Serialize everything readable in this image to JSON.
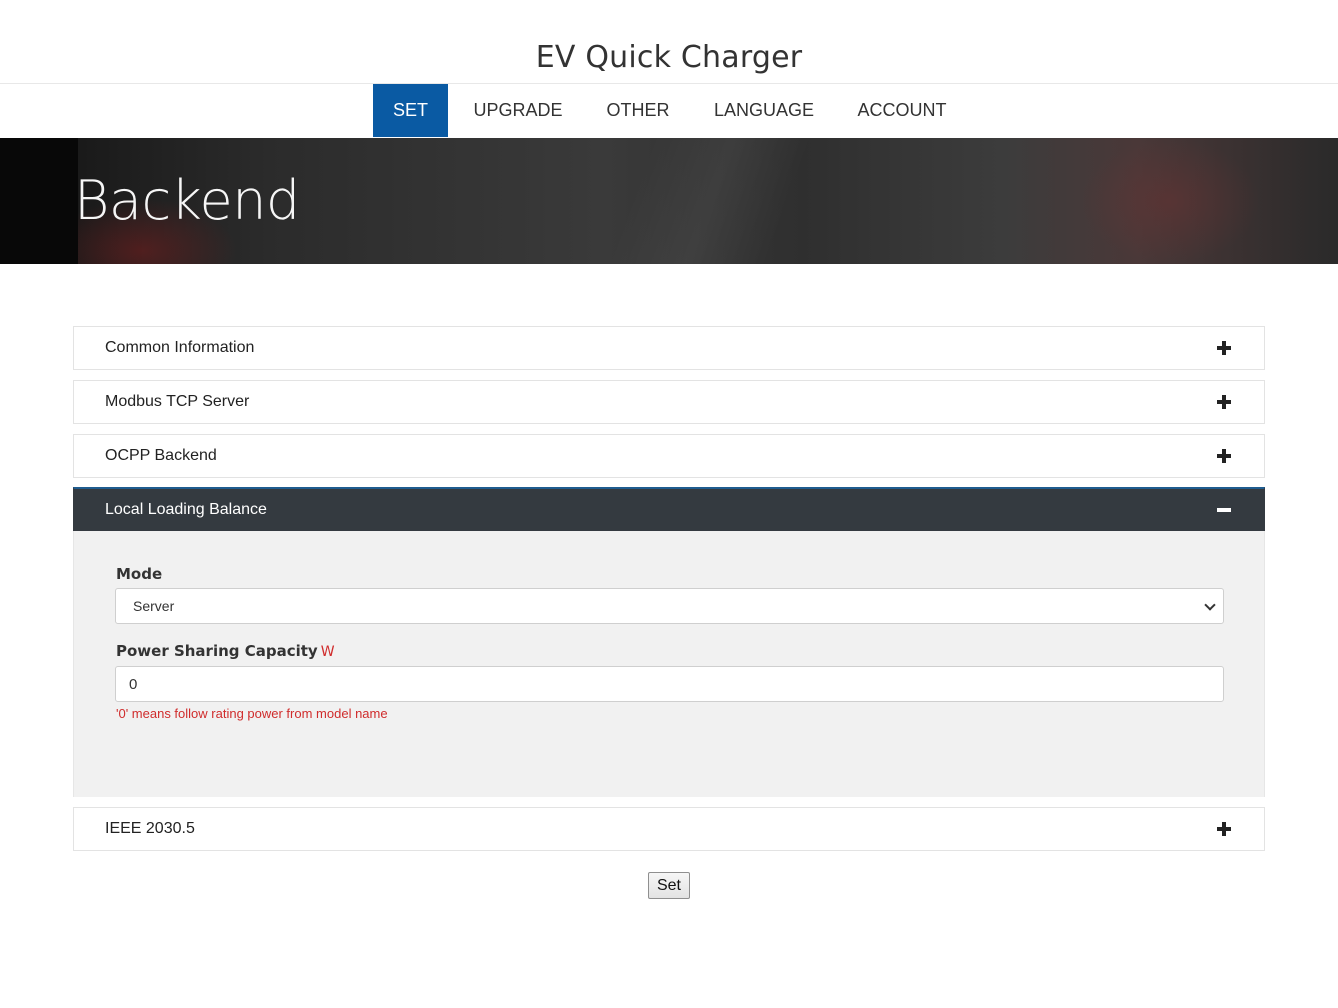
{
  "header": {
    "title": "EV Quick Charger"
  },
  "nav": {
    "items": [
      {
        "label": "SET",
        "active": true
      },
      {
        "label": "UPGRADE",
        "active": false
      },
      {
        "label": "OTHER",
        "active": false
      },
      {
        "label": "LANGUAGE",
        "active": false
      },
      {
        "label": "ACCOUNT",
        "active": false
      }
    ],
    "accent_color": "#0a5aa3"
  },
  "hero": {
    "title": "Backend"
  },
  "panels": [
    {
      "title": "Common Information",
      "expanded": false,
      "icon": "plus-icon"
    },
    {
      "title": "Modbus TCP Server",
      "expanded": false,
      "icon": "plus-icon"
    },
    {
      "title": "OCPP Backend",
      "expanded": false,
      "icon": "plus-icon"
    },
    {
      "title": "Local Loading Balance",
      "expanded": true,
      "icon": "minus-icon"
    },
    {
      "title": "IEEE 2030.5",
      "expanded": false,
      "icon": "plus-icon"
    }
  ],
  "local_loading_balance": {
    "mode_label": "Mode",
    "mode_value": "Server",
    "capacity_label": "Power Sharing Capacity",
    "capacity_unit": "W",
    "capacity_value": "0",
    "capacity_hint": "'0' means follow rating power from model name"
  },
  "actions": {
    "set_label": "Set"
  }
}
